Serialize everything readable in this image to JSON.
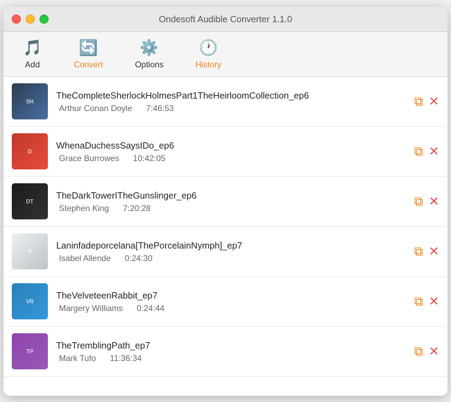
{
  "window": {
    "title": "Ondesoft Audible Converter 1.1.0"
  },
  "toolbar": {
    "add_label": "Add",
    "convert_label": "Convert",
    "options_label": "Options",
    "history_label": "History"
  },
  "books": [
    {
      "id": 1,
      "title": "TheCompleteSherlockHolmesPart1TheHeirloomCollection_ep6",
      "author": "Arthur Conan Doyle",
      "duration": "7:46:53",
      "cover_class": "cover-1",
      "cover_label": "SH"
    },
    {
      "id": 2,
      "title": "WhenaDuchessSaysIDo_ep6",
      "author": "Grace Burrowes",
      "duration": "10:42:05",
      "cover_class": "cover-2",
      "cover_label": "D"
    },
    {
      "id": 3,
      "title": "TheDarkTowerITheGunslinger_ep6",
      "author": "Stephen King",
      "duration": "7:20:28",
      "cover_class": "cover-3",
      "cover_label": "DT"
    },
    {
      "id": 4,
      "title": "Laninfadeporcelana[ThePorcelainNymph]_ep7",
      "author": "Isabel Allende",
      "duration": "0:24:30",
      "cover_class": "cover-4",
      "cover_label": "P"
    },
    {
      "id": 5,
      "title": "TheVelveteenRabbit_ep7",
      "author": "Margery Williams",
      "duration": "0:24:44",
      "cover_class": "cover-5",
      "cover_label": "VR"
    },
    {
      "id": 6,
      "title": "TheTremblingPath_ep7",
      "author": "Mark Tufo",
      "duration": "11:36:34",
      "cover_class": "cover-6",
      "cover_label": "TP"
    }
  ]
}
